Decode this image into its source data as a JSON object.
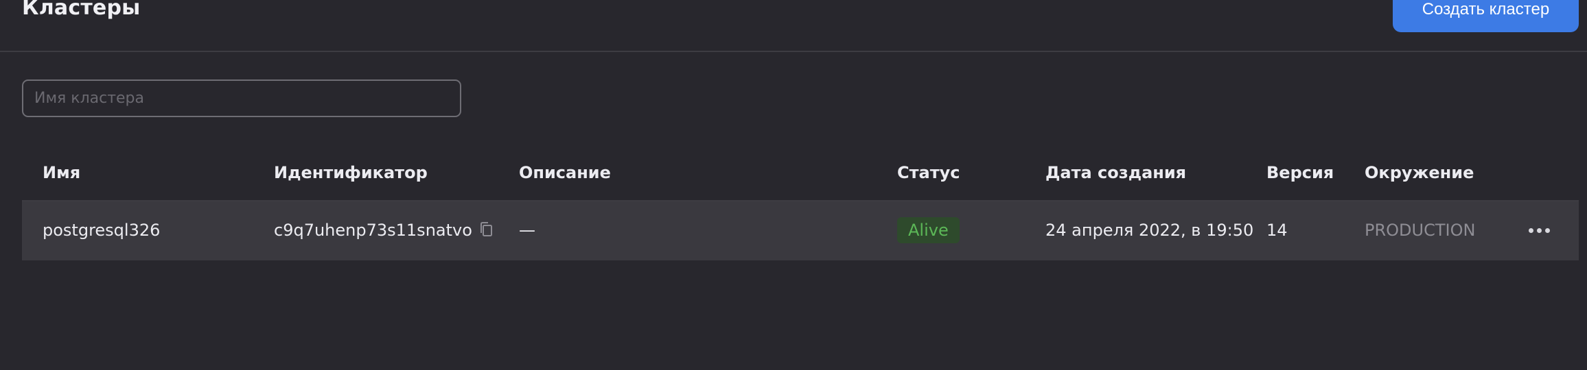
{
  "header": {
    "title": "Кластеры",
    "create_button_label": "Создать кластер"
  },
  "search": {
    "placeholder": "Имя кластера",
    "value": ""
  },
  "table": {
    "columns": [
      "Имя",
      "Идентификатор",
      "Описание",
      "Статус",
      "Дата создания",
      "Версия",
      "Окружение"
    ],
    "rows": [
      {
        "name": "postgresql326",
        "id": "c9q7uhenp73s11snatvo",
        "description": "—",
        "status": "Alive",
        "created": "24 апреля 2022, в 19:50",
        "version": "14",
        "environment": "PRODUCTION"
      }
    ]
  },
  "colors": {
    "background": "#28272d",
    "row_background": "#3a393f",
    "accent": "#3d7be5",
    "status_alive_text": "#5cb857",
    "status_alive_bg": "#2e4a2c",
    "muted_text": "#8e8d94"
  },
  "icons": {
    "copy": "copy-icon",
    "more": "more-dots-icon"
  }
}
